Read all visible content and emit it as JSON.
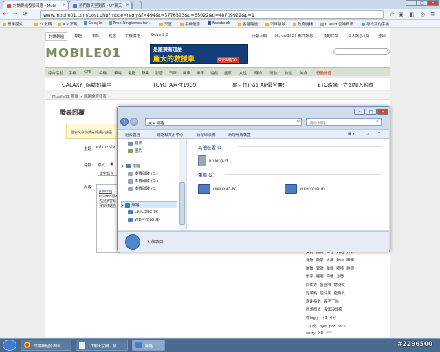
{
  "browser": {
    "tabs": [
      {
        "label": "討論群組發表回應 - Mobi"
      },
      {
        "label": "熱門聯天室列表 - UT聊天"
      }
    ],
    "url": "www.mobile01.com/post.php?mode=reply&f=494&t=3776593&u=65022&q=48709922&p=1",
    "bookmarks": [
      "應用程式",
      "3C數碼",
      "A.R.下載",
      "Google",
      "Free Ringtones for...",
      "天富",
      "手機優惠",
      "Facebook",
      "各種隨優",
      "汽車領域",
      "政府機構",
      "iCloud 雲端資訊",
      "尋找我的手機"
    ]
  },
  "site": {
    "topnav": [
      "討論群組",
      "專題",
      "市集",
      "點選",
      "手機價格",
      "Dove 2.0"
    ],
    "usernav": [
      "行動上網",
      "Hi, uni1121 郵件訊息",
      "我的文章",
      "私人訊息 (6)",
      "登出"
    ],
    "logo": "MOBILE01",
    "banner": {
      "line1": "是誰擁有這麼",
      "line2": "龐大的救援車",
      "cta": "快去揭曉GO"
    },
    "categories": [
      "綜合活動",
      "手機",
      "GPS",
      "相機",
      "筆電",
      "電腦",
      "蘋果",
      "影音",
      "汽車",
      "機車",
      "單車",
      "遊戲",
      "居家",
      "女性",
      "時尚",
      "運動",
      "旅遊",
      "美食",
      "行動加值"
    ],
    "ads": [
      "GALAXY J結試招募中",
      "TOYOTA月付1999",
      "尾牙抽iPad Air優宜賽!",
      "ETC路購一立即加入粉絲"
    ],
    "breadcrumb": "Mobile01 首頁 > 網路論壇發表",
    "page_title": "發表回覆",
    "notice": "發表文章前請先閱讀討論區",
    "subject_label": "主題:",
    "subject_value": "wd my clo",
    "format_label": "標籤:",
    "format_value": "樣式:",
    "format_select": "文字語合",
    "content_label": "內容:",
    "editor_lines": [
      "[Quote]",
      "UniBBB原本",
      "",
      "先說請容易",
      "我安裝結自"
    ],
    "emote_rows": [
      "支持 痛哭 自裡 大姐 打勢",
      "報酬 鼓掌 大擁 熱血 嘩嘩",
      "曬曬 緊張 離雜 哆嗦 幾啊",
      "數字 嘟嘟 呼嚕 沙發",
      "回相亦 盛盛唯 請問文",
      "點讚點 啞冷笑 抱臭孔",
      "讚謝指數 翼不了你",
      "愿求愿去 沒頭沒頭鋼",
      "你lag了 +1 0分",
      "100分 bye prz rock",
      "sorry XD ***"
    ]
  },
  "explorer": {
    "address": "網路",
    "search_placeholder": "搜尋 網路",
    "commands": [
      "組合管理",
      "網路和共用中心",
      "新增印表機",
      "新增無線裝置"
    ],
    "tree": [
      {
        "label": "視訊"
      },
      {
        "label": "圖片"
      },
      {
        "label": "電腦"
      },
      {
        "label": "本機磁碟 (C:)"
      },
      {
        "label": "本機磁碟 (D:)"
      },
      {
        "label": "本機磁碟 (E:)"
      },
      {
        "label": "網路"
      },
      {
        "label": "UNILONG-PC"
      },
      {
        "label": "WDMYCLOUD"
      }
    ],
    "groups": {
      "other": "其他裝置 (1)",
      "computers": "電腦 (2)"
    },
    "devices": {
      "other": "unilong-PC",
      "pc1": "UNILONG-PC",
      "pc2": "WDMYCLOUD"
    },
    "status": "3 個項目"
  },
  "taskbar": {
    "items": [
      "討論群組發表回...",
      "UT聊天空間 - 聊...",
      "網路"
    ],
    "watermark": "#2296500"
  }
}
